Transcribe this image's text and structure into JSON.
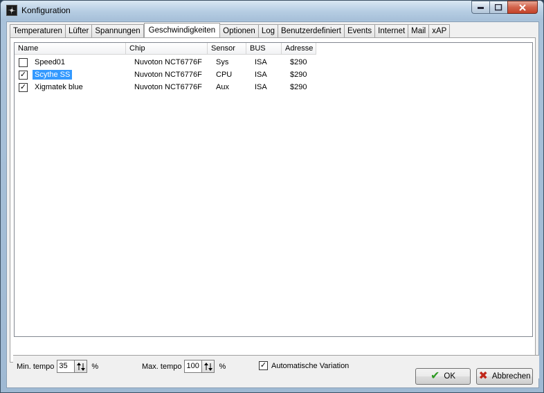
{
  "window": {
    "title": "Konfiguration"
  },
  "tabs": [
    {
      "label": "Temperaturen"
    },
    {
      "label": "Lüfter"
    },
    {
      "label": "Spannungen"
    },
    {
      "label": "Geschwindigkeiten",
      "active": true
    },
    {
      "label": "Optionen"
    },
    {
      "label": "Log"
    },
    {
      "label": "Benutzerdefiniert"
    },
    {
      "label": "Events"
    },
    {
      "label": "Internet"
    },
    {
      "label": "Mail"
    },
    {
      "label": "xAP"
    }
  ],
  "list": {
    "columns": [
      "Name",
      "Chip",
      "Sensor",
      "BUS",
      "Adresse"
    ],
    "rows": [
      {
        "checked": false,
        "name": "Speed01",
        "chip": "Nuvoton NCT6776F",
        "sensor": "Sys",
        "bus": "ISA",
        "address": "$290",
        "selected": false
      },
      {
        "checked": true,
        "name": "Scythe SS",
        "chip": "Nuvoton NCT6776F",
        "sensor": "CPU",
        "bus": "ISA",
        "address": "$290",
        "selected": true
      },
      {
        "checked": true,
        "name": "Xigmatek blue",
        "chip": "Nuvoton NCT6776F",
        "sensor": "Aux",
        "bus": "ISA",
        "address": "$290",
        "selected": false
      }
    ]
  },
  "controls": {
    "min_label": "Min. tempo",
    "min_value": "35",
    "max_label": "Max. tempo",
    "max_value": "100",
    "unit": "%",
    "auto_variation_label": "Automatische Variation",
    "auto_variation_checked": true
  },
  "buttons": {
    "ok": "OK",
    "cancel": "Abbrechen"
  },
  "colors": {
    "selection": "#3399ff",
    "ok_icon": "#2d9a22",
    "cancel_icon": "#c0271a"
  }
}
